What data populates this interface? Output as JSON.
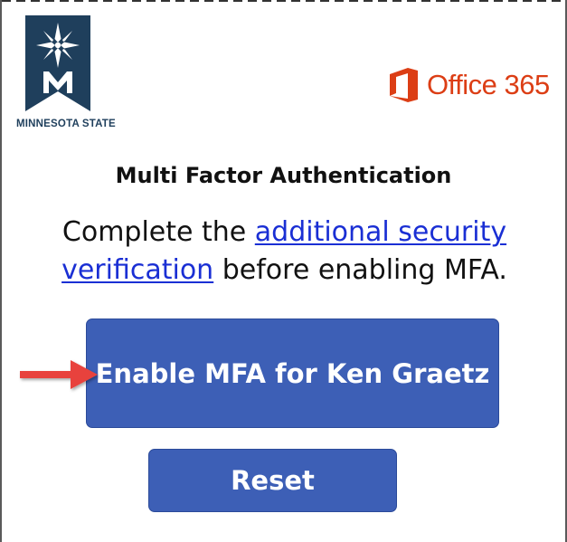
{
  "logo": {
    "brand_text": "MINNESOTA STATE",
    "color": "#1f3f5c"
  },
  "office": {
    "text": "Office 365",
    "color": "#dc3e15"
  },
  "heading": "Multi Factor Authentication",
  "message": {
    "prefix": "Complete the ",
    "link_text": "additional security verification",
    "suffix": " before enabling MFA.",
    "link_color": "#1a2fd4"
  },
  "buttons": {
    "enable_label": "Enable MFA for Ken Graetz",
    "reset_label": "Reset",
    "color": "#3d5fb6"
  },
  "annotation": {
    "arrow_color": "#e8433c",
    "icon": "arrow-right-icon"
  }
}
